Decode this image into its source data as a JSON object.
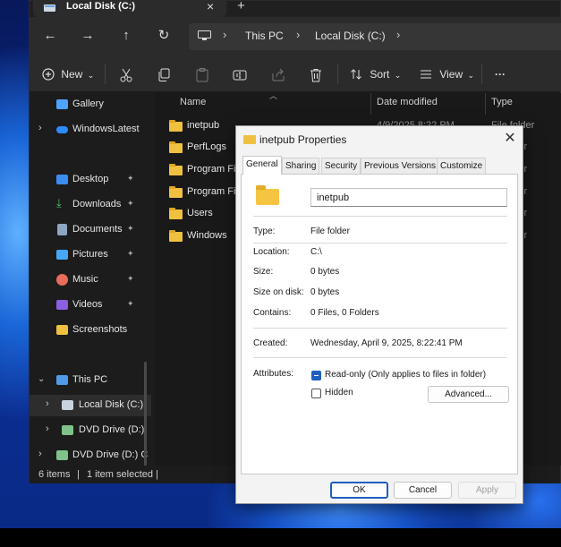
{
  "explorer": {
    "tab_title": "Local Disk (C:)",
    "tab_close": "×",
    "tab_new": "+",
    "nav": {
      "back": "←",
      "forward": "→",
      "up": "↑",
      "refresh": "↻"
    },
    "breadcrumb": [
      "This PC",
      "Local Disk (C:)"
    ],
    "breadcrumb_sep": "›",
    "toolbar": {
      "new_label": "New",
      "sort_label": "Sort",
      "view_label": "View",
      "more": "···",
      "caret": "⌄"
    },
    "sidebar": {
      "items": [
        {
          "label": "Gallery"
        },
        {
          "label": "WindowsLatest"
        },
        {
          "label": "Desktop"
        },
        {
          "label": "Downloads"
        },
        {
          "label": "Documents"
        },
        {
          "label": "Pictures"
        },
        {
          "label": "Music"
        },
        {
          "label": "Videos"
        },
        {
          "label": "Screenshots"
        },
        {
          "label": "This PC"
        },
        {
          "label": "Local Disk (C:)"
        },
        {
          "label": "DVD Drive (D:)"
        },
        {
          "label": "DVD Drive (D:) C"
        }
      ],
      "pin": "📌"
    },
    "columns": {
      "name": "Name",
      "date": "Date modified",
      "type": "Type"
    },
    "files": [
      {
        "name": "inetpub",
        "date": "4/9/2025 8:22 PM",
        "type": "File folder"
      },
      {
        "name": "PerfLogs",
        "date": "",
        "type": "ler"
      },
      {
        "name": "Program Files",
        "date": "",
        "type": "ler"
      },
      {
        "name": "Program Files (x86)",
        "date": "",
        "type": "ler"
      },
      {
        "name": "Users",
        "date": "",
        "type": "ler"
      },
      {
        "name": "Windows",
        "date": "",
        "type": "ler"
      }
    ],
    "status": {
      "count": "6 items",
      "selected": "1 item selected",
      "sep": "|"
    }
  },
  "dialog": {
    "title": "inetpub Properties",
    "close": "✕",
    "tabs": [
      "General",
      "Sharing",
      "Security",
      "Previous Versions",
      "Customize"
    ],
    "name_value": "inetpub",
    "props": {
      "type_label": "Type:",
      "type_value": "File folder",
      "location_label": "Location:",
      "location_value": "C:\\",
      "size_label": "Size:",
      "size_value": "0 bytes",
      "size_on_disk_label": "Size on disk:",
      "size_on_disk_value": "0 bytes",
      "contains_label": "Contains:",
      "contains_value": "0 Files, 0 Folders",
      "created_label": "Created:",
      "created_value": "Wednesday, April 9, 2025, 8:22:41 PM",
      "attributes_label": "Attributes:",
      "readonly_label": "Read-only (Only applies to files in folder)",
      "hidden_label": "Hidden",
      "advanced_label": "Advanced..."
    },
    "buttons": {
      "ok": "OK",
      "cancel": "Cancel",
      "apply": "Apply"
    }
  }
}
